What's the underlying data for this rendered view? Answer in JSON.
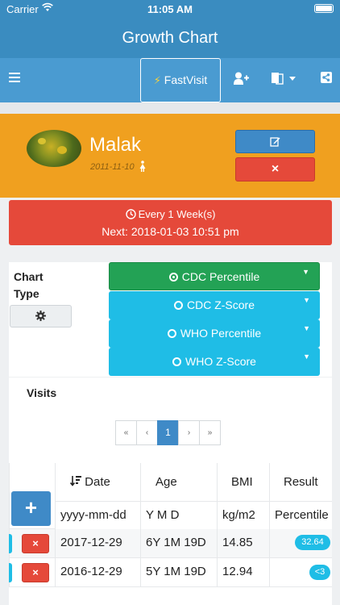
{
  "status_bar": {
    "carrier": "Carrier",
    "time": "11:05 AM"
  },
  "header": {
    "title": "Growth Chart"
  },
  "toolbar": {
    "fast_visit_label": "FastVisit",
    "icons": [
      "menu-icon",
      "bolt-icon",
      "add-user-icon",
      "translate-icon",
      "share-icon"
    ]
  },
  "profile": {
    "name": "Malak",
    "dob": "2011-11-10",
    "edit_icon": "edit-icon",
    "delete_icon": "×"
  },
  "reminder": {
    "line1": "Every 1 Week(s)",
    "line2": "Next: 2018-01-03 10:51 pm"
  },
  "chart_type": {
    "label": "Chart Type",
    "options": [
      {
        "label": "CDC Percentile",
        "selected": true
      },
      {
        "label": "CDC Z-Score",
        "selected": false
      },
      {
        "label": "WHO Percentile",
        "selected": false
      },
      {
        "label": "WHO Z-Score",
        "selected": false
      }
    ]
  },
  "visits": {
    "title": "Visits",
    "pagination": [
      "«",
      "‹",
      "1",
      "›",
      "»"
    ],
    "columns": [
      "Date",
      "Age",
      "BMI",
      "Result"
    ],
    "units": [
      "yyyy-mm-dd",
      "Y M D",
      "kg/m2",
      "Percentile"
    ],
    "add_label": "+",
    "rows": [
      {
        "date": "2017-12-29",
        "age": "6Y 1M 19D",
        "bmi": "14.85",
        "result": "32.64"
      },
      {
        "date": "2016-12-29",
        "age": "5Y 1M 19D",
        "bmi": "12.94",
        "result": "<3"
      }
    ],
    "delete_label": "×"
  },
  "colors": {
    "primary": "#3a8cc0",
    "toolbar": "#4a9bd1",
    "profile_bg": "#f0a01f",
    "danger": "#e5493a",
    "success": "#23a255",
    "info": "#1fbde6"
  }
}
